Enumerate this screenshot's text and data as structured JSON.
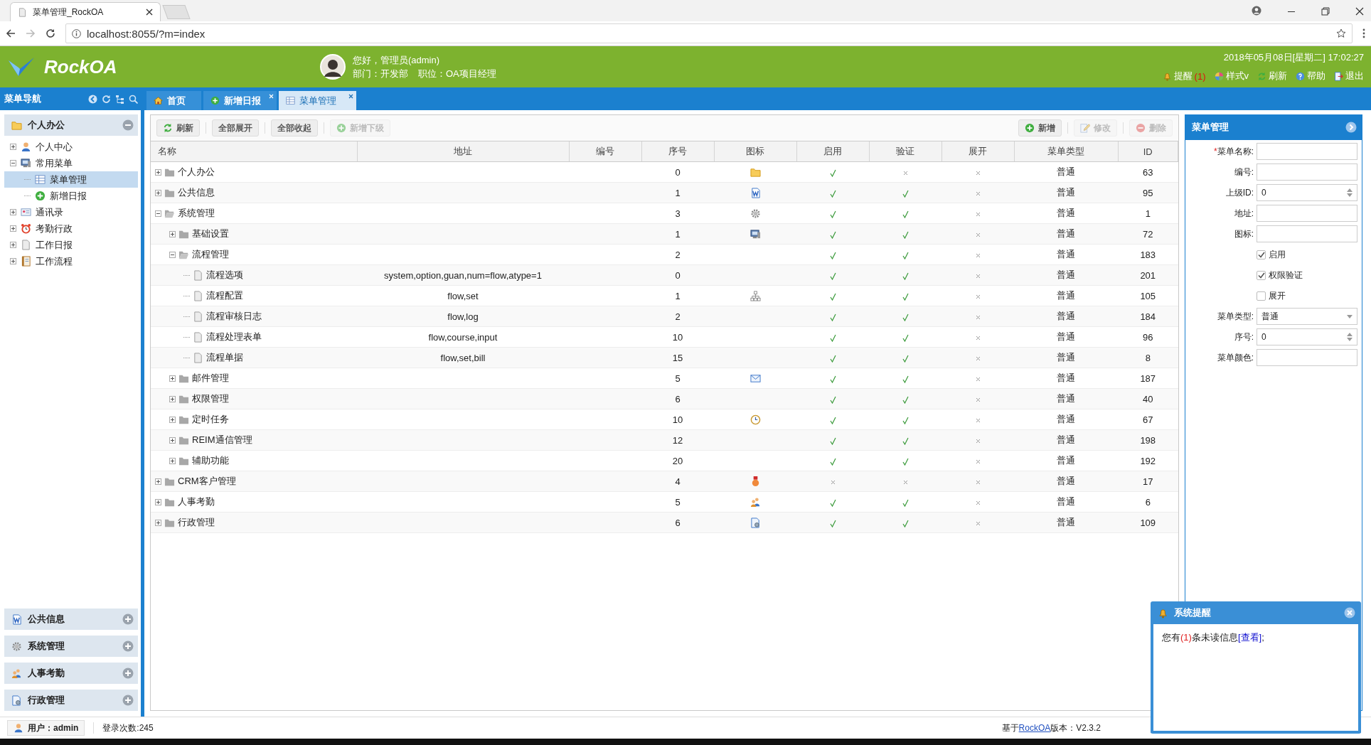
{
  "browser": {
    "tab_title": "菜单管理_RockOA",
    "url": "localhost:8055/?m=index"
  },
  "header": {
    "logo": "RockOA",
    "greeting": "您好，管理员(admin)",
    "department": "部门：开发部",
    "position": "职位：OA项目经理",
    "datetime": "2018年05月08日[星期二] 17:02:27",
    "links": [
      {
        "label": "提醒",
        "badge": "(1)",
        "kind": "bell"
      },
      {
        "label": "样式v",
        "kind": "palette"
      },
      {
        "label": "刷新",
        "kind": "refresh"
      },
      {
        "label": "帮助",
        "kind": "help"
      },
      {
        "label": "退出",
        "kind": "exit"
      }
    ]
  },
  "nav": {
    "title": "菜单导航",
    "tabs": [
      {
        "label": "首页",
        "kind": "home",
        "closable": false,
        "selected": false
      },
      {
        "label": "新增日报",
        "kind": "plus",
        "closable": true,
        "selected": false
      },
      {
        "label": "菜单管理",
        "kind": "table",
        "closable": true,
        "selected": true
      }
    ]
  },
  "sidebar": {
    "sections": [
      {
        "title": "个人办公",
        "kind": "folder",
        "expanded": true,
        "items": [
          {
            "label": "个人中心",
            "kind": "person",
            "expanded": false,
            "selected": false
          },
          {
            "label": "常用菜单",
            "kind": "monitor",
            "expanded": true,
            "selected": false,
            "children": [
              {
                "label": "菜单管理",
                "kind": "table",
                "selected": true
              },
              {
                "label": "新增日报",
                "kind": "plus",
                "selected": false
              }
            ]
          },
          {
            "label": "通讯录",
            "kind": "card",
            "expanded": false,
            "selected": false
          },
          {
            "label": "考勤行政",
            "kind": "alarm",
            "expanded": false,
            "selected": false
          },
          {
            "label": "工作日报",
            "kind": "page",
            "expanded": false,
            "selected": false
          },
          {
            "label": "工作流程",
            "kind": "notebook",
            "expanded": false,
            "selected": false
          }
        ]
      },
      {
        "title": "公共信息",
        "kind": "word",
        "expanded": false
      },
      {
        "title": "系统管理",
        "kind": "gear",
        "expanded": false
      },
      {
        "title": "人事考勤",
        "kind": "people",
        "expanded": false
      },
      {
        "title": "行政管理",
        "kind": "docgear",
        "expanded": false
      }
    ]
  },
  "toolbar": {
    "left": [
      {
        "label": "刷新",
        "kind": "refresh",
        "disabled": false
      },
      {
        "label": "全部展开",
        "disabled": false
      },
      {
        "label": "全部收起",
        "disabled": false
      },
      {
        "label": "新增下级",
        "kind": "plus",
        "disabled": true
      }
    ],
    "right": [
      {
        "label": "新增",
        "kind": "plus",
        "disabled": false
      },
      {
        "label": "修改",
        "kind": "edit",
        "disabled": true
      },
      {
        "label": "删除",
        "kind": "minus",
        "disabled": true
      }
    ]
  },
  "table": {
    "columns": [
      "名称",
      "地址",
      "编号",
      "序号",
      "图标",
      "启用",
      "验证",
      "展开",
      "菜单类型",
      "ID"
    ],
    "rows": [
      {
        "name": "个人办公",
        "expanded": false,
        "order": "0",
        "kind": "folder",
        "enabled": true,
        "verify": false,
        "expand": false,
        "type": "普通",
        "id": "63"
      },
      {
        "name": "公共信息",
        "expanded": false,
        "order": "1",
        "kind": "word",
        "enabled": true,
        "verify": true,
        "expand": false,
        "type": "普通",
        "id": "95"
      },
      {
        "name": "系统管理",
        "expanded": true,
        "order": "3",
        "kind": "gear",
        "enabled": true,
        "verify": true,
        "expand": false,
        "type": "普通",
        "id": "1",
        "children": [
          {
            "name": "基础设置",
            "expanded": false,
            "order": "1",
            "kind": "monitor",
            "enabled": true,
            "verify": true,
            "expand": false,
            "type": "普通",
            "id": "72"
          },
          {
            "name": "流程管理",
            "expanded": true,
            "order": "2",
            "enabled": true,
            "verify": true,
            "expand": false,
            "type": "普通",
            "id": "183",
            "children": [
              {
                "name": "流程选项",
                "address": "system,option,guan,num=flow,atype=1",
                "order": "0",
                "enabled": true,
                "verify": true,
                "expand": false,
                "type": "普通",
                "id": "201"
              },
              {
                "name": "流程配置",
                "address": "flow,set",
                "order": "1",
                "kind": "hierarchy",
                "enabled": true,
                "verify": true,
                "expand": false,
                "type": "普通",
                "id": "105"
              },
              {
                "name": "流程审核日志",
                "address": "flow,log",
                "order": "2",
                "enabled": true,
                "verify": true,
                "expand": false,
                "type": "普通",
                "id": "184"
              },
              {
                "name": "流程处理表单",
                "address": "flow,course,input",
                "order": "10",
                "enabled": true,
                "verify": true,
                "expand": false,
                "type": "普通",
                "id": "96"
              },
              {
                "name": "流程单据",
                "address": "flow,set,bill",
                "order": "15",
                "enabled": true,
                "verify": true,
                "expand": false,
                "type": "普通",
                "id": "8"
              }
            ]
          },
          {
            "name": "邮件管理",
            "expanded": false,
            "order": "5",
            "kind": "envelope",
            "enabled": true,
            "verify": true,
            "expand": false,
            "type": "普通",
            "id": "187"
          },
          {
            "name": "权限管理",
            "expanded": false,
            "order": "6",
            "enabled": true,
            "verify": true,
            "expand": false,
            "type": "普通",
            "id": "40"
          },
          {
            "name": "定时任务",
            "expanded": false,
            "order": "10",
            "kind": "clock",
            "enabled": true,
            "verify": true,
            "expand": false,
            "type": "普通",
            "id": "67"
          },
          {
            "name": "REIM通信管理",
            "expanded": false,
            "order": "12",
            "enabled": true,
            "verify": true,
            "expand": false,
            "type": "普通",
            "id": "198"
          },
          {
            "name": "辅助功能",
            "expanded": false,
            "order": "20",
            "enabled": true,
            "verify": true,
            "expand": false,
            "type": "普通",
            "id": "192"
          }
        ]
      },
      {
        "name": "CRM客户管理",
        "expanded": false,
        "order": "4",
        "kind": "medal",
        "enabled": false,
        "verify": false,
        "expand": false,
        "type": "普通",
        "id": "17"
      },
      {
        "name": "人事考勤",
        "expanded": false,
        "order": "5",
        "kind": "people",
        "enabled": true,
        "verify": true,
        "expand": false,
        "type": "普通",
        "id": "6"
      },
      {
        "name": "行政管理",
        "expanded": false,
        "order": "6",
        "kind": "docgear",
        "enabled": true,
        "verify": true,
        "expand": false,
        "type": "普通",
        "id": "109"
      }
    ]
  },
  "form": {
    "title": "菜单管理",
    "fields": [
      {
        "kind": "text",
        "label": "菜单名称:",
        "marker": "*"
      },
      {
        "kind": "text",
        "label": "编号:"
      },
      {
        "kind": "spinner",
        "label": "上级ID:",
        "value": "0"
      },
      {
        "kind": "text",
        "label": "地址:"
      },
      {
        "kind": "text",
        "label": "图标:"
      },
      {
        "kind": "checkbox",
        "label": "启用",
        "checked": true
      },
      {
        "kind": "checkbox",
        "label": "权限验证",
        "checked": true
      },
      {
        "kind": "checkbox",
        "label": "展开",
        "checked": false
      },
      {
        "kind": "select",
        "label": "菜单类型:",
        "value": "普通"
      },
      {
        "kind": "spinner",
        "label": "序号:",
        "value": "0"
      },
      {
        "kind": "text",
        "label": "菜单颜色:"
      }
    ]
  },
  "popup": {
    "title": "系统提醒",
    "message": {
      "before": "您有",
      "count": "(1)",
      "middle": "条未读信息",
      "link": "[查看]",
      "after": ";"
    }
  },
  "status_bar": {
    "user": "用户：admin",
    "logins": "登录次数:245",
    "footer_prefix": "基于",
    "footer_link": "RockOA",
    "footer_suffix": "版本：V2.3.2"
  }
}
